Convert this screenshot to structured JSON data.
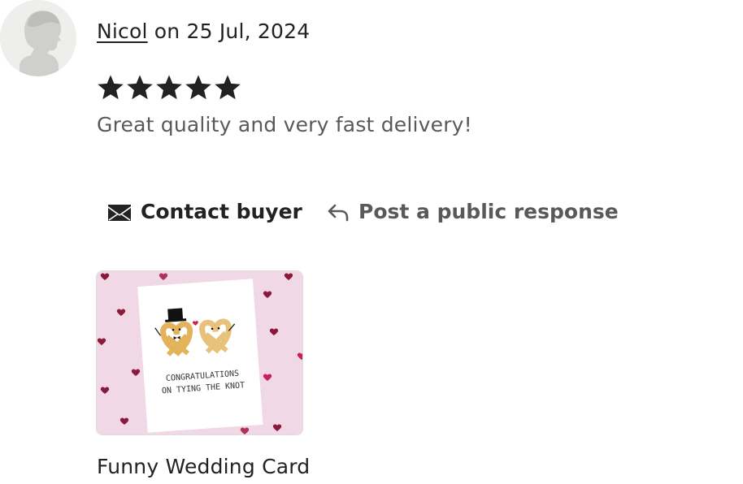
{
  "review": {
    "reviewer_name": "Nicol",
    "date_prefix": "on",
    "date": "25 Jul, 2024",
    "rating": 5,
    "rating_max": 5,
    "text": "Great quality and very fast delivery!"
  },
  "actions": {
    "contact_label": "Contact buyer",
    "response_label": "Post a public response"
  },
  "product": {
    "title": "Funny Wedding Card",
    "image_caption_line1": "CONGRATULATIONS",
    "image_caption_line2": "ON TYING THE KNOT"
  },
  "icons": {
    "avatar": "default-avatar-icon",
    "star": "star-icon",
    "contact": "envelope-icon",
    "response": "reply-arrow-icon"
  },
  "colors": {
    "text_primary": "#222222",
    "text_secondary": "#595959",
    "avatar_bg": "#eeeeec",
    "thumb_bg": "#f1d8e6",
    "heart": "#8b1a3a"
  }
}
